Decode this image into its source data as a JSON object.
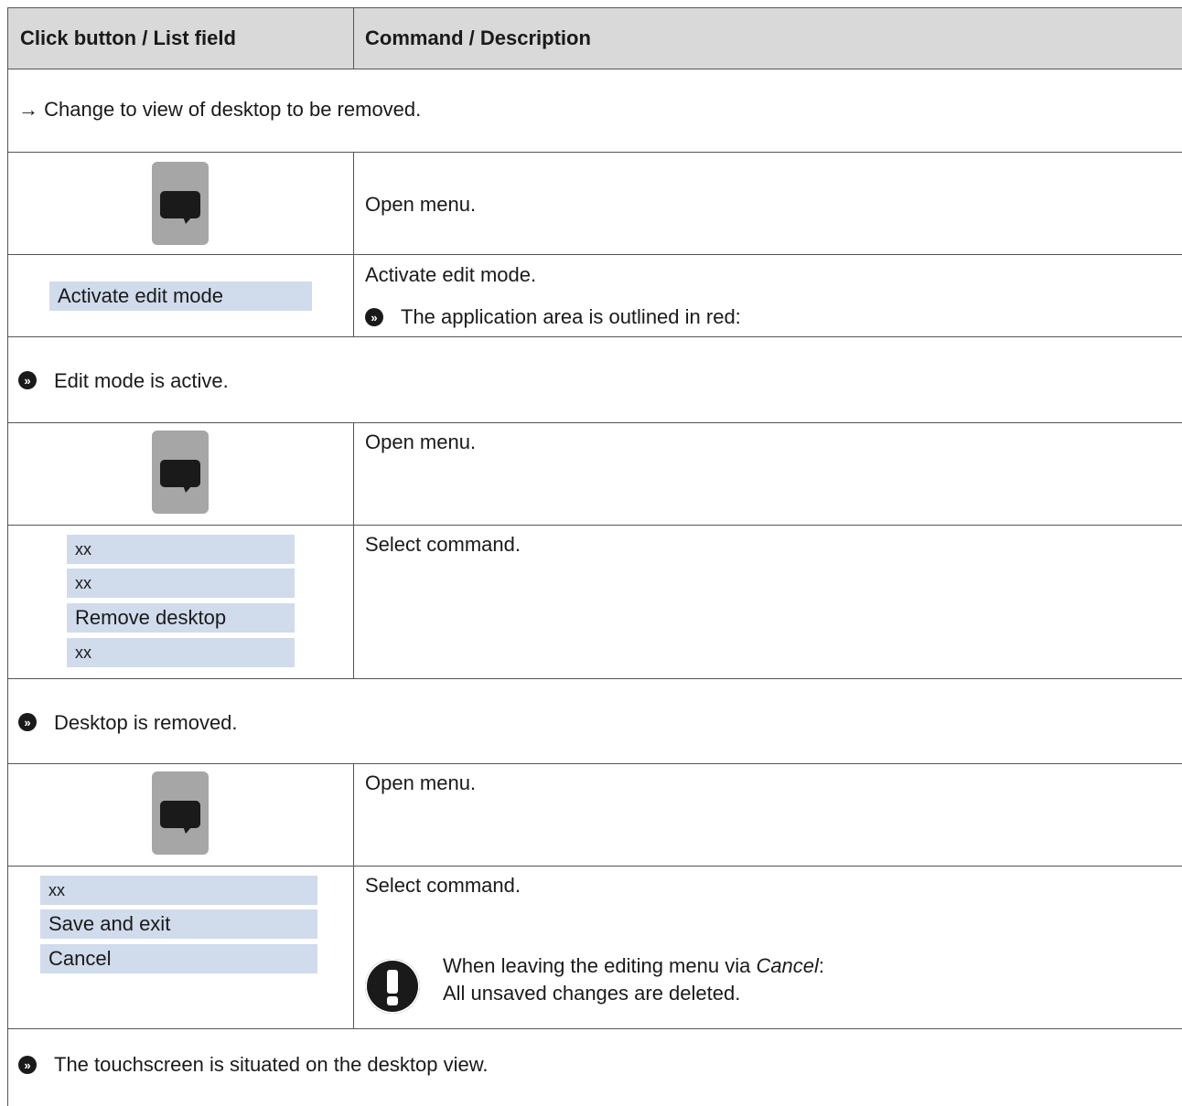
{
  "header": {
    "col1": "Click button / List field",
    "col2": "Command / Description"
  },
  "rows": {
    "intro": {
      "arrow": "→",
      "text": "Change to view of desktop to be removed."
    },
    "open_menu_1": {
      "description": "Open menu.",
      "icon": "menu-speech-bubble-icon"
    },
    "activate": {
      "list_label": "Activate edit mode",
      "description": "Activate edit mode.",
      "result_text": "The application area is outlined in red:"
    },
    "edit_active": {
      "result_text": "Edit mode is active."
    },
    "open_menu_2": {
      "description": "Open menu.",
      "icon": "menu-speech-bubble-icon"
    },
    "select_remove": {
      "items": [
        "xx",
        "xx",
        "Remove desktop",
        "xx"
      ],
      "description": "Select command."
    },
    "removed": {
      "result_text": "Desktop is removed."
    },
    "open_menu_3": {
      "description": "Open menu.",
      "icon": "menu-speech-bubble-icon"
    },
    "select_save": {
      "items": [
        "xx",
        "Save and exit",
        "Cancel"
      ],
      "description": "Select command.",
      "note_line1_prefix": "When leaving the editing menu via ",
      "note_line1_italic": "Cancel",
      "note_line1_suffix": ":",
      "note_line2": "All unsaved changes are deleted.",
      "icon": "exclamation-warning-icon"
    },
    "final": {
      "result_text": "The touchscreen is situated on the desktop view."
    }
  },
  "result_symbol": "»",
  "colors": {
    "header_bg": "#d9d9d9",
    "list_item_bg": "#d0dbec",
    "menu_button_bg": "#a6a6a6",
    "border": "#555555"
  }
}
